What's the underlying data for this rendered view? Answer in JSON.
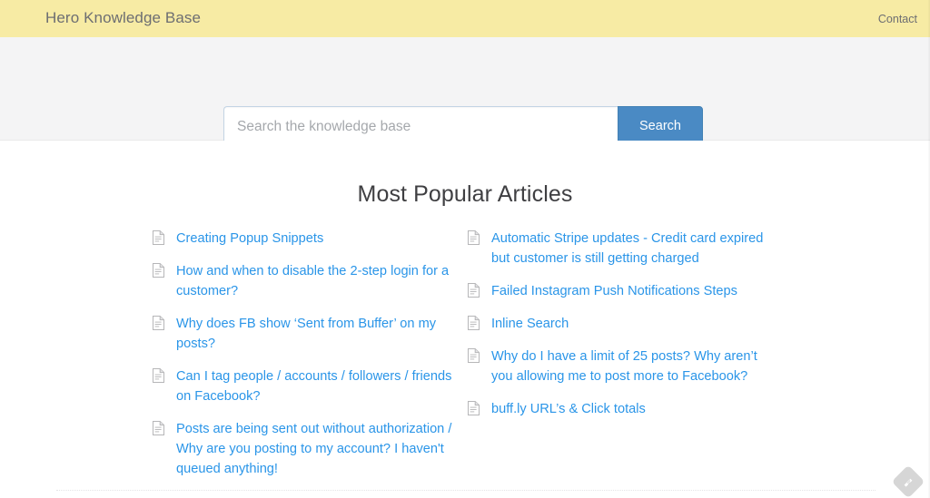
{
  "header": {
    "brand": "Hero Knowledge Base",
    "nav": [
      {
        "label": "Contact"
      }
    ],
    "background_color": "#f7eba4",
    "text_color": "#6d6e72"
  },
  "search": {
    "placeholder": "Search the knowledge base",
    "value": "",
    "button_label": "Search",
    "button_color": "#4a8ac4",
    "band_color": "#f4f4f5"
  },
  "main": {
    "title": "Most Popular Articles",
    "link_color": "#2a95e8",
    "icon_name": "document-icon",
    "columns": [
      {
        "name": "left",
        "articles": [
          {
            "title": "Creating Popup Snippets"
          },
          {
            "title": "How and when to disable the 2-step login for a customer?"
          },
          {
            "title": "Why does FB show ‘Sent from Buffer’ on my posts?"
          },
          {
            "title": "Can I tag people / accounts / followers / friends on Facebook?"
          },
          {
            "title": "Posts are being sent out without authorization / Why are you posting to my account? I haven't queued anything!"
          }
        ]
      },
      {
        "name": "right",
        "articles": [
          {
            "title": "Automatic Stripe updates - Credit card expired but customer is still getting charged"
          },
          {
            "title": "Failed Instagram Push Notifications Steps"
          },
          {
            "title": "Inline Search"
          },
          {
            "title": "Why do I have a limit of 25 posts? Why aren’t you allowing me to post more to Facebook?"
          },
          {
            "title": "buff.ly URL’s & Click totals"
          }
        ]
      }
    ]
  },
  "footer": {
    "badge_name": "feedly-badge-icon",
    "badge_color": "#d6d6d6"
  }
}
